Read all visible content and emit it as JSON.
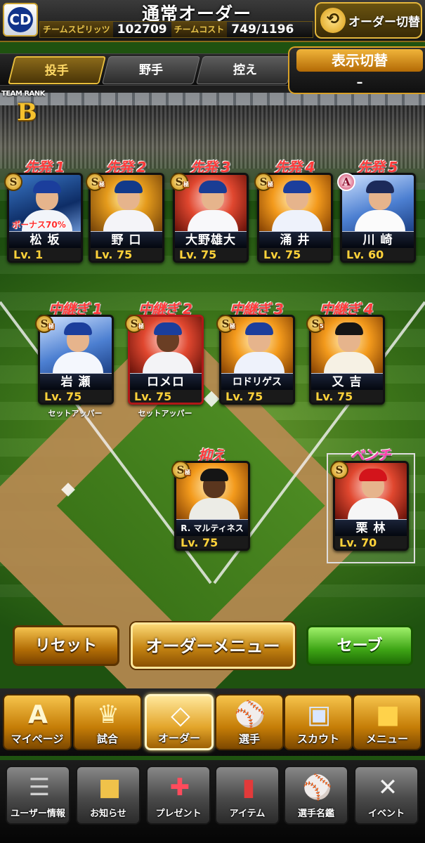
{
  "header": {
    "title": "通常オーダー",
    "team_logo": "CD",
    "team_spirit_label": "チームスピリッツ",
    "team_spirit_value": "102709",
    "team_cost_label": "チームコスト",
    "team_cost_value": "749/1196",
    "order_switch_label": "オーダー切替",
    "order_switch_icon": "cycle-arrows-icon"
  },
  "tabs": {
    "items": [
      "投手",
      "野手",
      "控え"
    ],
    "active": "投手"
  },
  "display_switch": {
    "title": "表示切替",
    "value": "–"
  },
  "team_rank": {
    "label": "TEAM RANK",
    "value": "B"
  },
  "starters": [
    {
      "slot": "先発 1",
      "name": "松 坂",
      "level": "Lv.  1",
      "badge": "S",
      "bonus": "ボーナス70%"
    },
    {
      "slot": "先発 2",
      "name": "野 口",
      "level": "Lv. 75",
      "badge": "S",
      "badge_sub": "極"
    },
    {
      "slot": "先発 3",
      "name": "大野雄大",
      "level": "Lv. 75",
      "badge": "S",
      "badge_sub": "極"
    },
    {
      "slot": "先発 4",
      "name": "涌 井",
      "level": "Lv. 75",
      "badge": "S",
      "badge_sub": "極"
    },
    {
      "slot": "先発 5",
      "name": "川 崎",
      "level": "Lv. 60",
      "badge": "A"
    }
  ],
  "relievers": [
    {
      "slot": "中継ぎ 1",
      "name": "岩 瀬",
      "level": "Lv. 75",
      "badge": "S",
      "badge_sub": "極",
      "role": "セットアッパー"
    },
    {
      "slot": "中継ぎ 2",
      "name": "ロメロ",
      "level": "Lv. 75",
      "badge": "S",
      "badge_sub": "極",
      "role": "セットアッパー"
    },
    {
      "slot": "中継ぎ 3",
      "name": "ロドリゲス",
      "level": "Lv. 75",
      "badge": "S",
      "badge_sub": "極"
    },
    {
      "slot": "中継ぎ 4",
      "name": "又 吉",
      "level": "Lv. 75",
      "badge": "S",
      "badge_sub": "5"
    }
  ],
  "closer": {
    "slot": "抑え",
    "name": "R. マルティネス",
    "level": "Lv. 75",
    "badge": "S",
    "badge_sub": "極"
  },
  "bench": {
    "slot": "ベンチ",
    "name": "栗 林",
    "level": "Lv. 70",
    "badge": "S"
  },
  "actions": {
    "reset": "リセット",
    "order_menu": "オーダーメニュー",
    "save": "セーブ"
  },
  "nav_main": [
    {
      "label": "マイページ",
      "icon": "mypage-icon"
    },
    {
      "label": "試合",
      "icon": "trophy-icon"
    },
    {
      "label": "オーダー",
      "icon": "field-icon"
    },
    {
      "label": "選手",
      "icon": "player-icon"
    },
    {
      "label": "スカウト",
      "icon": "scout-card-icon"
    },
    {
      "label": "メニュー",
      "icon": "menu-icon"
    }
  ],
  "nav_sub": [
    {
      "label": "ユーザー情報",
      "icon": "user-info-icon"
    },
    {
      "label": "お知らせ",
      "icon": "notice-icon"
    },
    {
      "label": "プレゼント",
      "icon": "gift-icon"
    },
    {
      "label": "アイテム",
      "icon": "item-book-icon"
    },
    {
      "label": "選手名鑑",
      "icon": "player-directory-icon"
    },
    {
      "label": "イベント",
      "icon": "event-icon"
    }
  ],
  "colors": {
    "accent_gold": "#e3b63c",
    "slot_label_red": "#ff3b3b",
    "bench_label_pink": "#ff3fae",
    "save_green": "#3fa616",
    "level_yellow": "#ffd23a"
  }
}
